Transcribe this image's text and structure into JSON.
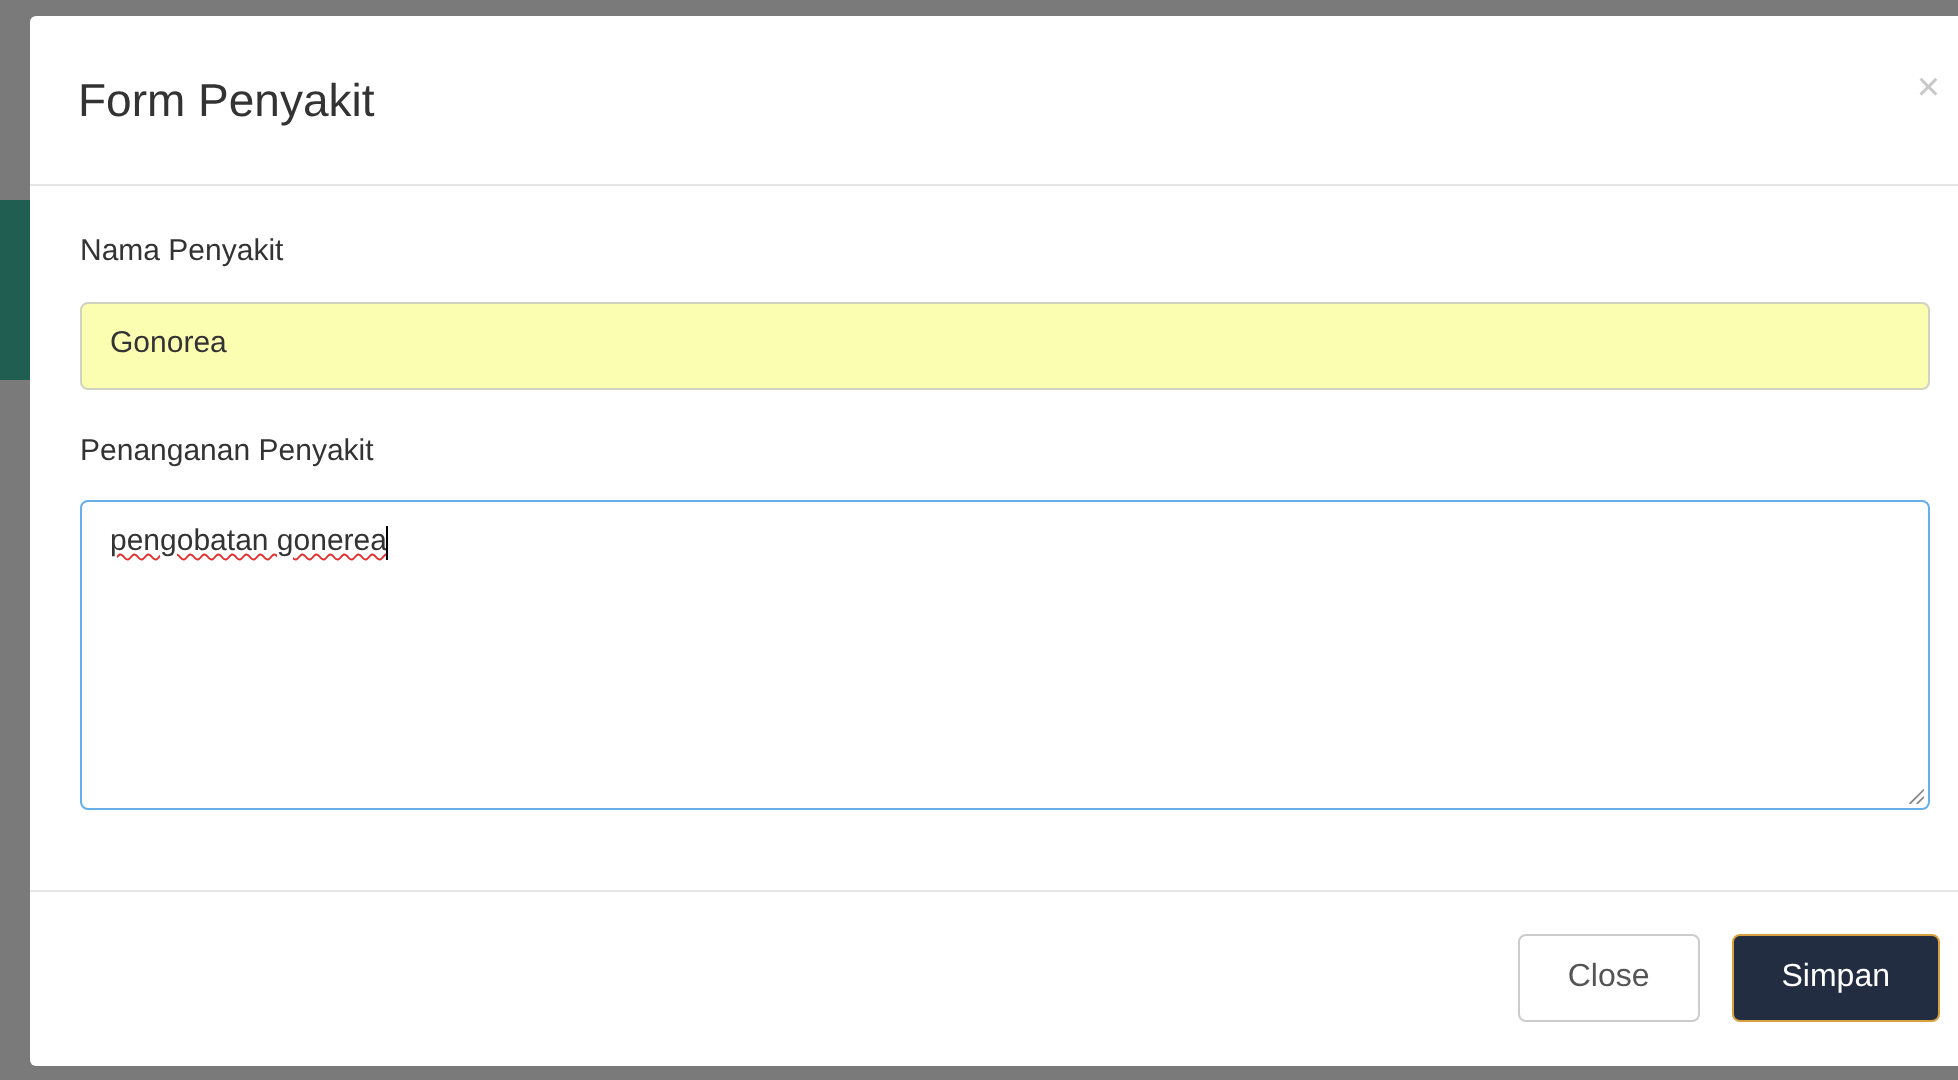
{
  "modal": {
    "title": "Form Penyakit",
    "close_icon": "×"
  },
  "fields": [
    {
      "kind": "input",
      "label": "Nama Penyakit",
      "value": "Gonorea",
      "autofilled": true,
      "focused": false,
      "misspelled": false
    },
    {
      "kind": "textarea",
      "label": "Penanganan Penyakit",
      "value": "pengobatan gonerea",
      "autofilled": false,
      "focused": true,
      "misspelled": true
    }
  ],
  "buttons": [
    {
      "label": "Close",
      "kind": "secondary"
    },
    {
      "label": "Simpan",
      "kind": "primary"
    }
  ]
}
